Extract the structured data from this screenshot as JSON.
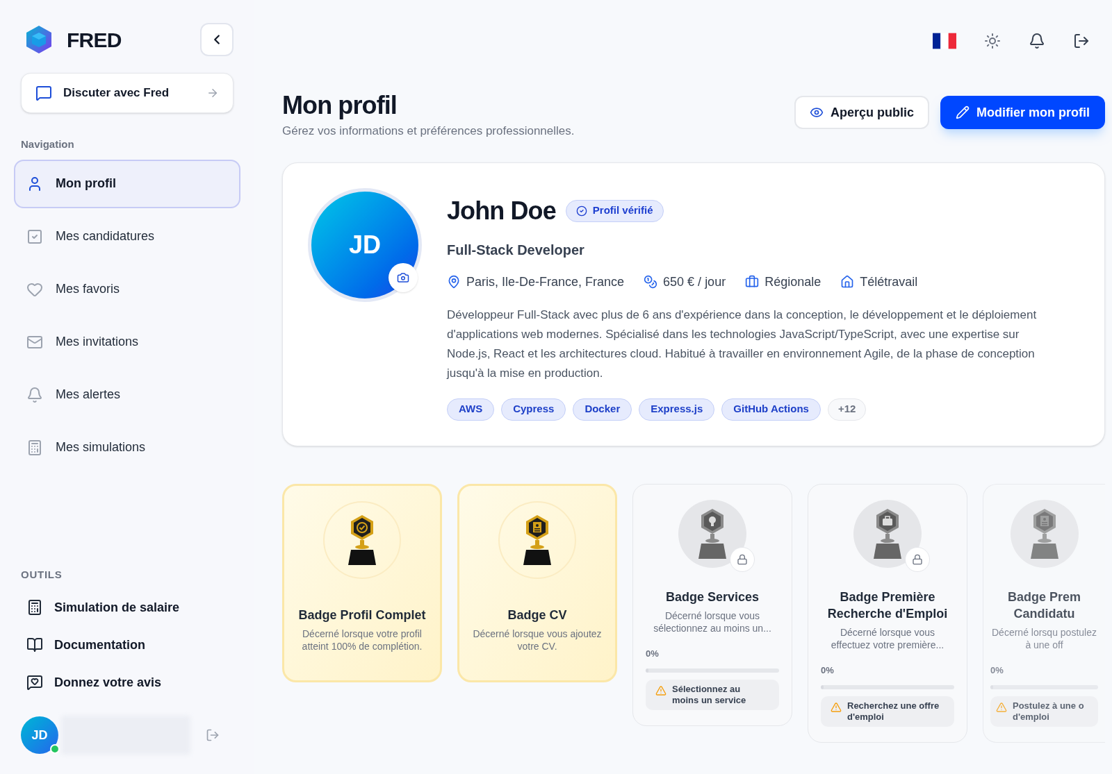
{
  "brand": {
    "name": "FRED"
  },
  "chat_button": {
    "label": "Discuter avec Fred"
  },
  "navigation": {
    "title": "Navigation",
    "items": [
      {
        "label": "Mon profil",
        "selected": true
      },
      {
        "label": "Mes candidatures",
        "selected": false
      },
      {
        "label": "Mes favoris",
        "selected": false
      },
      {
        "label": "Mes invitations",
        "selected": false
      },
      {
        "label": "Mes alertes",
        "selected": false
      },
      {
        "label": "Mes simulations",
        "selected": false
      }
    ]
  },
  "tools": {
    "title": "OUTILS",
    "items": [
      {
        "label": "Simulation de salaire"
      },
      {
        "label": "Documentation"
      },
      {
        "label": "Donnez votre avis"
      }
    ]
  },
  "user": {
    "initials": "JD",
    "online": true
  },
  "page": {
    "title": "Mon profil",
    "subtitle": "Gérez vos informations et préférences professionnelles.",
    "buttons": [
      {
        "label": "Aperçu public",
        "kind": "secondary"
      },
      {
        "label": "Modifier mon profil",
        "kind": "primary"
      }
    ]
  },
  "profile": {
    "initials": "JD",
    "name": "John Doe",
    "verified_badge": "Profil vérifié",
    "headline": "Full-Stack Developer",
    "facts": [
      "Paris, Ile-De-France, France",
      "650 € / jour",
      "Régionale",
      "Télétravail"
    ],
    "bio": "Développeur Full-Stack avec plus de 6 ans d'expérience dans la conception, le développement et le déploiement d'applications web modernes. Spécialisé dans les technologies JavaScript/TypeScript, avec une expertise sur Node.js, React et les architectures cloud. Habitué à travailler en environnement Agile, de la phase de conception jusqu'à la mise en production.",
    "skills": [
      {
        "label": "AWS",
        "kind": "skill"
      },
      {
        "label": "Cypress",
        "kind": "skill"
      },
      {
        "label": "Docker",
        "kind": "skill"
      },
      {
        "label": "Express.js",
        "kind": "skill"
      },
      {
        "label": "GitHub Actions",
        "kind": "skill"
      },
      {
        "label": "+12",
        "kind": "more"
      }
    ]
  },
  "badges": [
    {
      "title": "Badge Profil Complet",
      "description": "Décerné lorsque votre profil atteint 100% de complétion.",
      "kind": "earned"
    },
    {
      "title": "Badge CV",
      "description": "Décerné lorsque vous ajoutez votre CV.",
      "kind": "earned"
    },
    {
      "title": "Badge Services",
      "description": "Décerné lorsque vous sélectionnez au moins un...",
      "kind": "locked",
      "progress": "0%",
      "level": 0,
      "hint": "Sélectionnez au moins un service"
    },
    {
      "title": "Badge Première Recherche d'Emploi",
      "description": "Décerné lorsque vous effectuez votre première...",
      "kind": "locked",
      "progress": "0%",
      "level": 0,
      "hint": "Recherchez une offre d'emploi"
    },
    {
      "title": "Badge Prem Candidatu",
      "description": "Décerné lorsqu postulez à une off",
      "kind": "partial",
      "progress": "0%",
      "level": 0,
      "hint": "Postulez à une o d'emploi"
    }
  ]
}
